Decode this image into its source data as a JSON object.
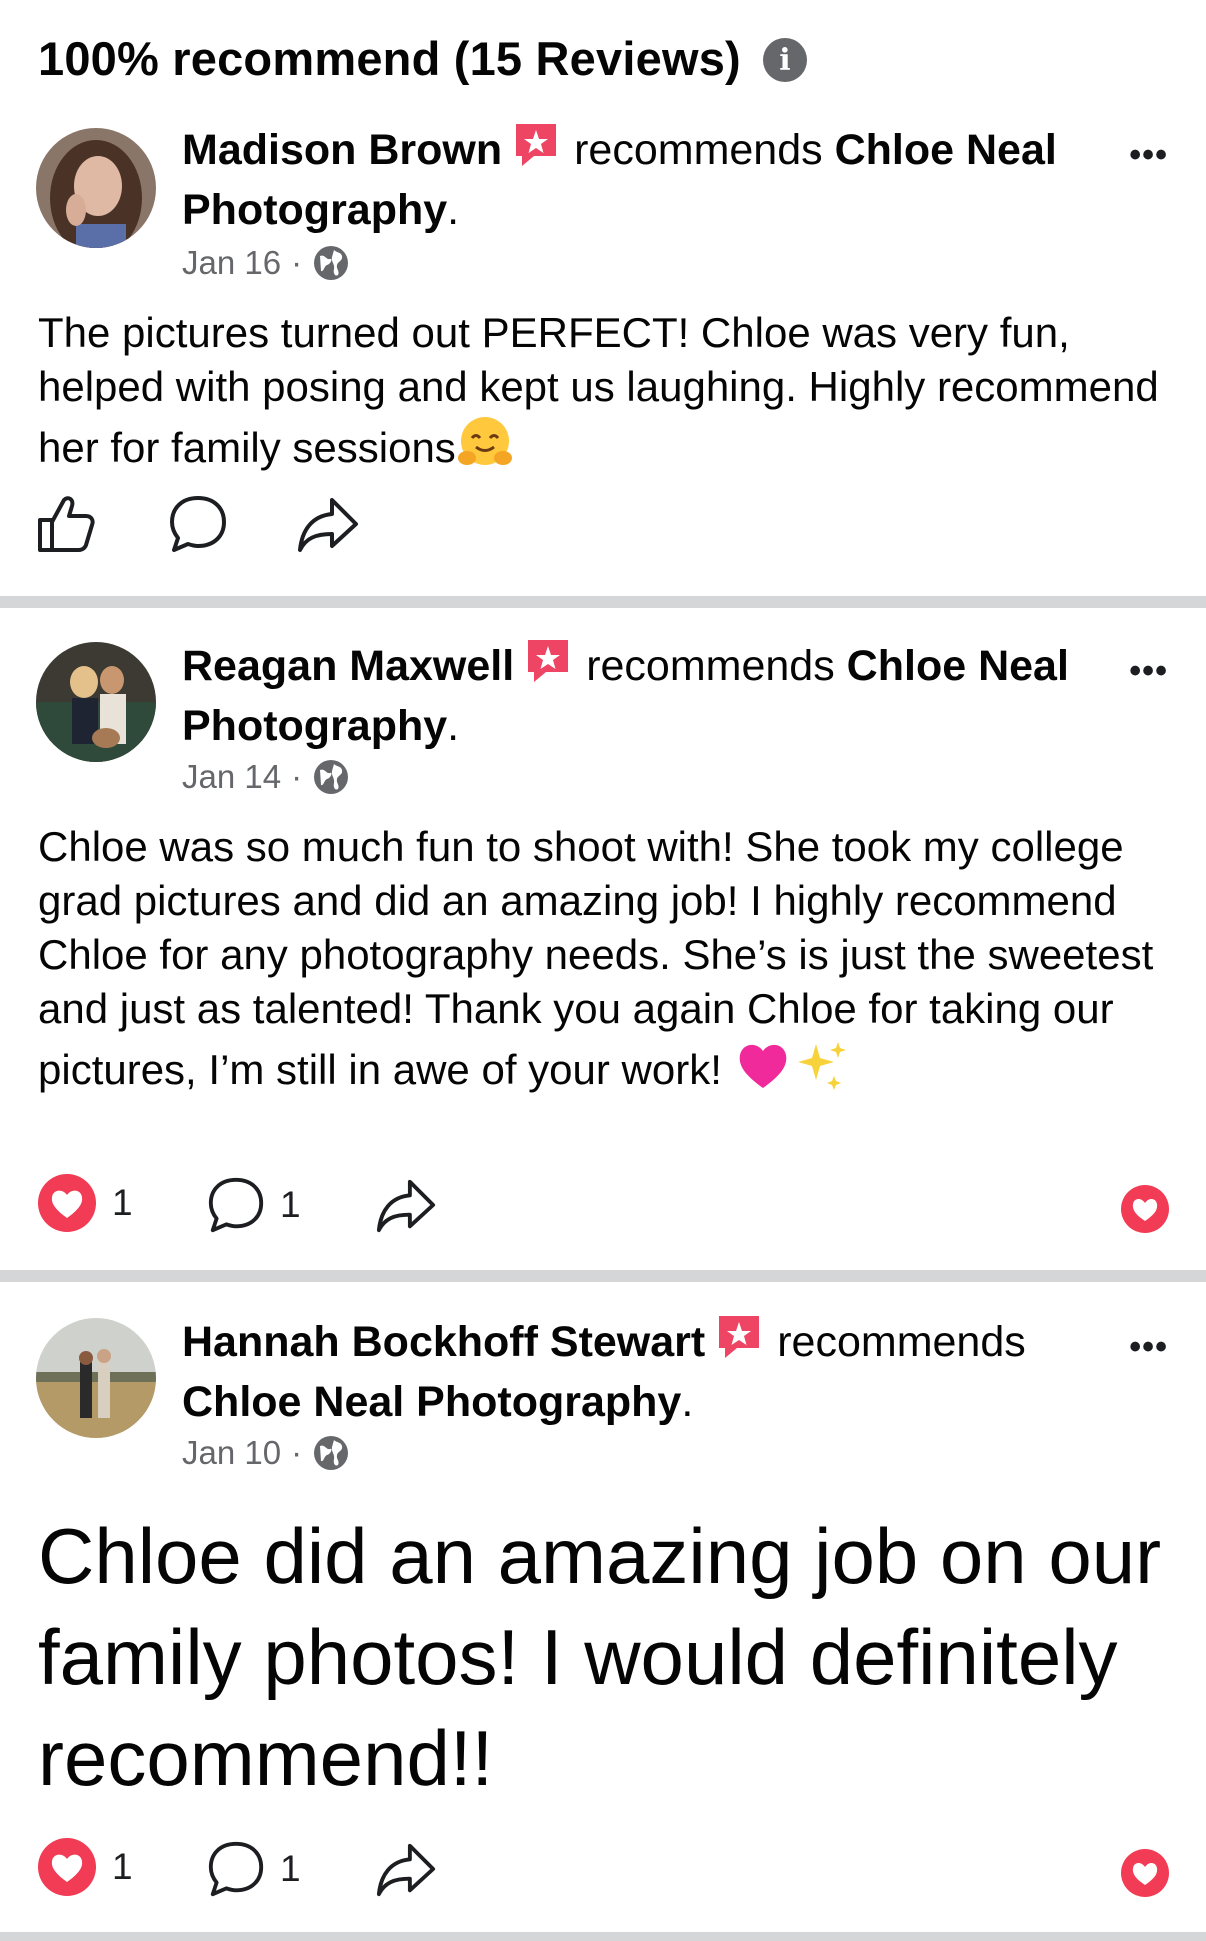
{
  "header": {
    "title": "100% recommend (15 Reviews)",
    "info_icon": "info-icon"
  },
  "colors": {
    "love": "#f23b55",
    "badge": "#ee4564",
    "muted": "#65676b",
    "divider": "#d5d6d8"
  },
  "reviews": [
    {
      "name": "Madison Brown",
      "recommends": "recommends",
      "page": "Chloe Neal Photography",
      "date": "Jan 16",
      "text": "The pictures turned out PERFECT! Chloe was very fun, helped with posing and kept us laughing. Highly recommend her for family sessions",
      "emoji": "hugging-face-emoji",
      "love_count": "",
      "comment_count": ""
    },
    {
      "name": "Reagan Maxwell",
      "recommends": "recommends",
      "page": "Chloe Neal Photography",
      "date": "Jan 14",
      "text": "Chloe was so much fun to shoot with! She took my college grad pictures and did an amazing job! I highly recommend Chloe for any photography needs. She’s is just the sweetest and just as talented! Thank you again Chloe for taking our pictures, I’m still in awe of your work!",
      "emoji": "pink-heart-sparkles-emoji",
      "love_count": "1",
      "comment_count": "1"
    },
    {
      "name": "Hannah Bockhoff Stewart",
      "recommends": "recommends",
      "page": "Chloe Neal Photography",
      "date": "Jan 10",
      "text": "Chloe did an amazing job on our family photos! I would definitely recommend!!",
      "love_count": "1",
      "comment_count": "1"
    }
  ]
}
